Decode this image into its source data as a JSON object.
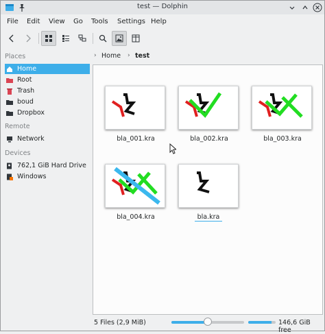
{
  "window": {
    "title": "test — Dolphin"
  },
  "menu": [
    "File",
    "Edit",
    "View",
    "Go",
    "Tools",
    "Settings",
    "Help"
  ],
  "toolbar": {
    "back_icon": "chevron-left-icon",
    "forward_icon": "chevron-right-icon",
    "icons_view": "icons-view-icon",
    "compact_view": "compact-view-icon",
    "details_view": "details-view-icon",
    "search": "search-icon",
    "preview": "preview-icon",
    "split": "split-view-icon"
  },
  "places": {
    "header": "Places",
    "items": [
      {
        "label": "Home",
        "icon": "home-icon",
        "selected": true
      },
      {
        "label": "Root",
        "icon": "folder-red-icon"
      },
      {
        "label": "Trash",
        "icon": "trash-icon"
      },
      {
        "label": "boud",
        "icon": "folder-icon"
      },
      {
        "label": "Dropbox",
        "icon": "dropbox-icon"
      }
    ]
  },
  "remote": {
    "header": "Remote",
    "items": [
      {
        "label": "Network",
        "icon": "network-icon"
      }
    ]
  },
  "devices": {
    "header": "Devices",
    "items": [
      {
        "label": "762,1 GiB Hard Drive",
        "icon": "hard-drive-icon"
      },
      {
        "label": "Windows",
        "icon": "windows-drive-icon"
      }
    ]
  },
  "breadcrumb": {
    "home": "Home",
    "current": "test"
  },
  "files": [
    {
      "name": "bla_001.kra"
    },
    {
      "name": "bla_002.kra"
    },
    {
      "name": "bla_003.kra"
    },
    {
      "name": "bla_004.kra"
    },
    {
      "name": "bla.kra"
    }
  ],
  "status": {
    "summary": "5 Files (2,9 MiB)",
    "zoom_fraction": 0.5,
    "free_space": "146,6 GiB free",
    "used_fraction": 0.85
  },
  "colors": {
    "accent": "#3daee9",
    "stroke_red": "#e02020",
    "stroke_green": "#22dd22",
    "stroke_cyan": "#3bb8ee"
  }
}
